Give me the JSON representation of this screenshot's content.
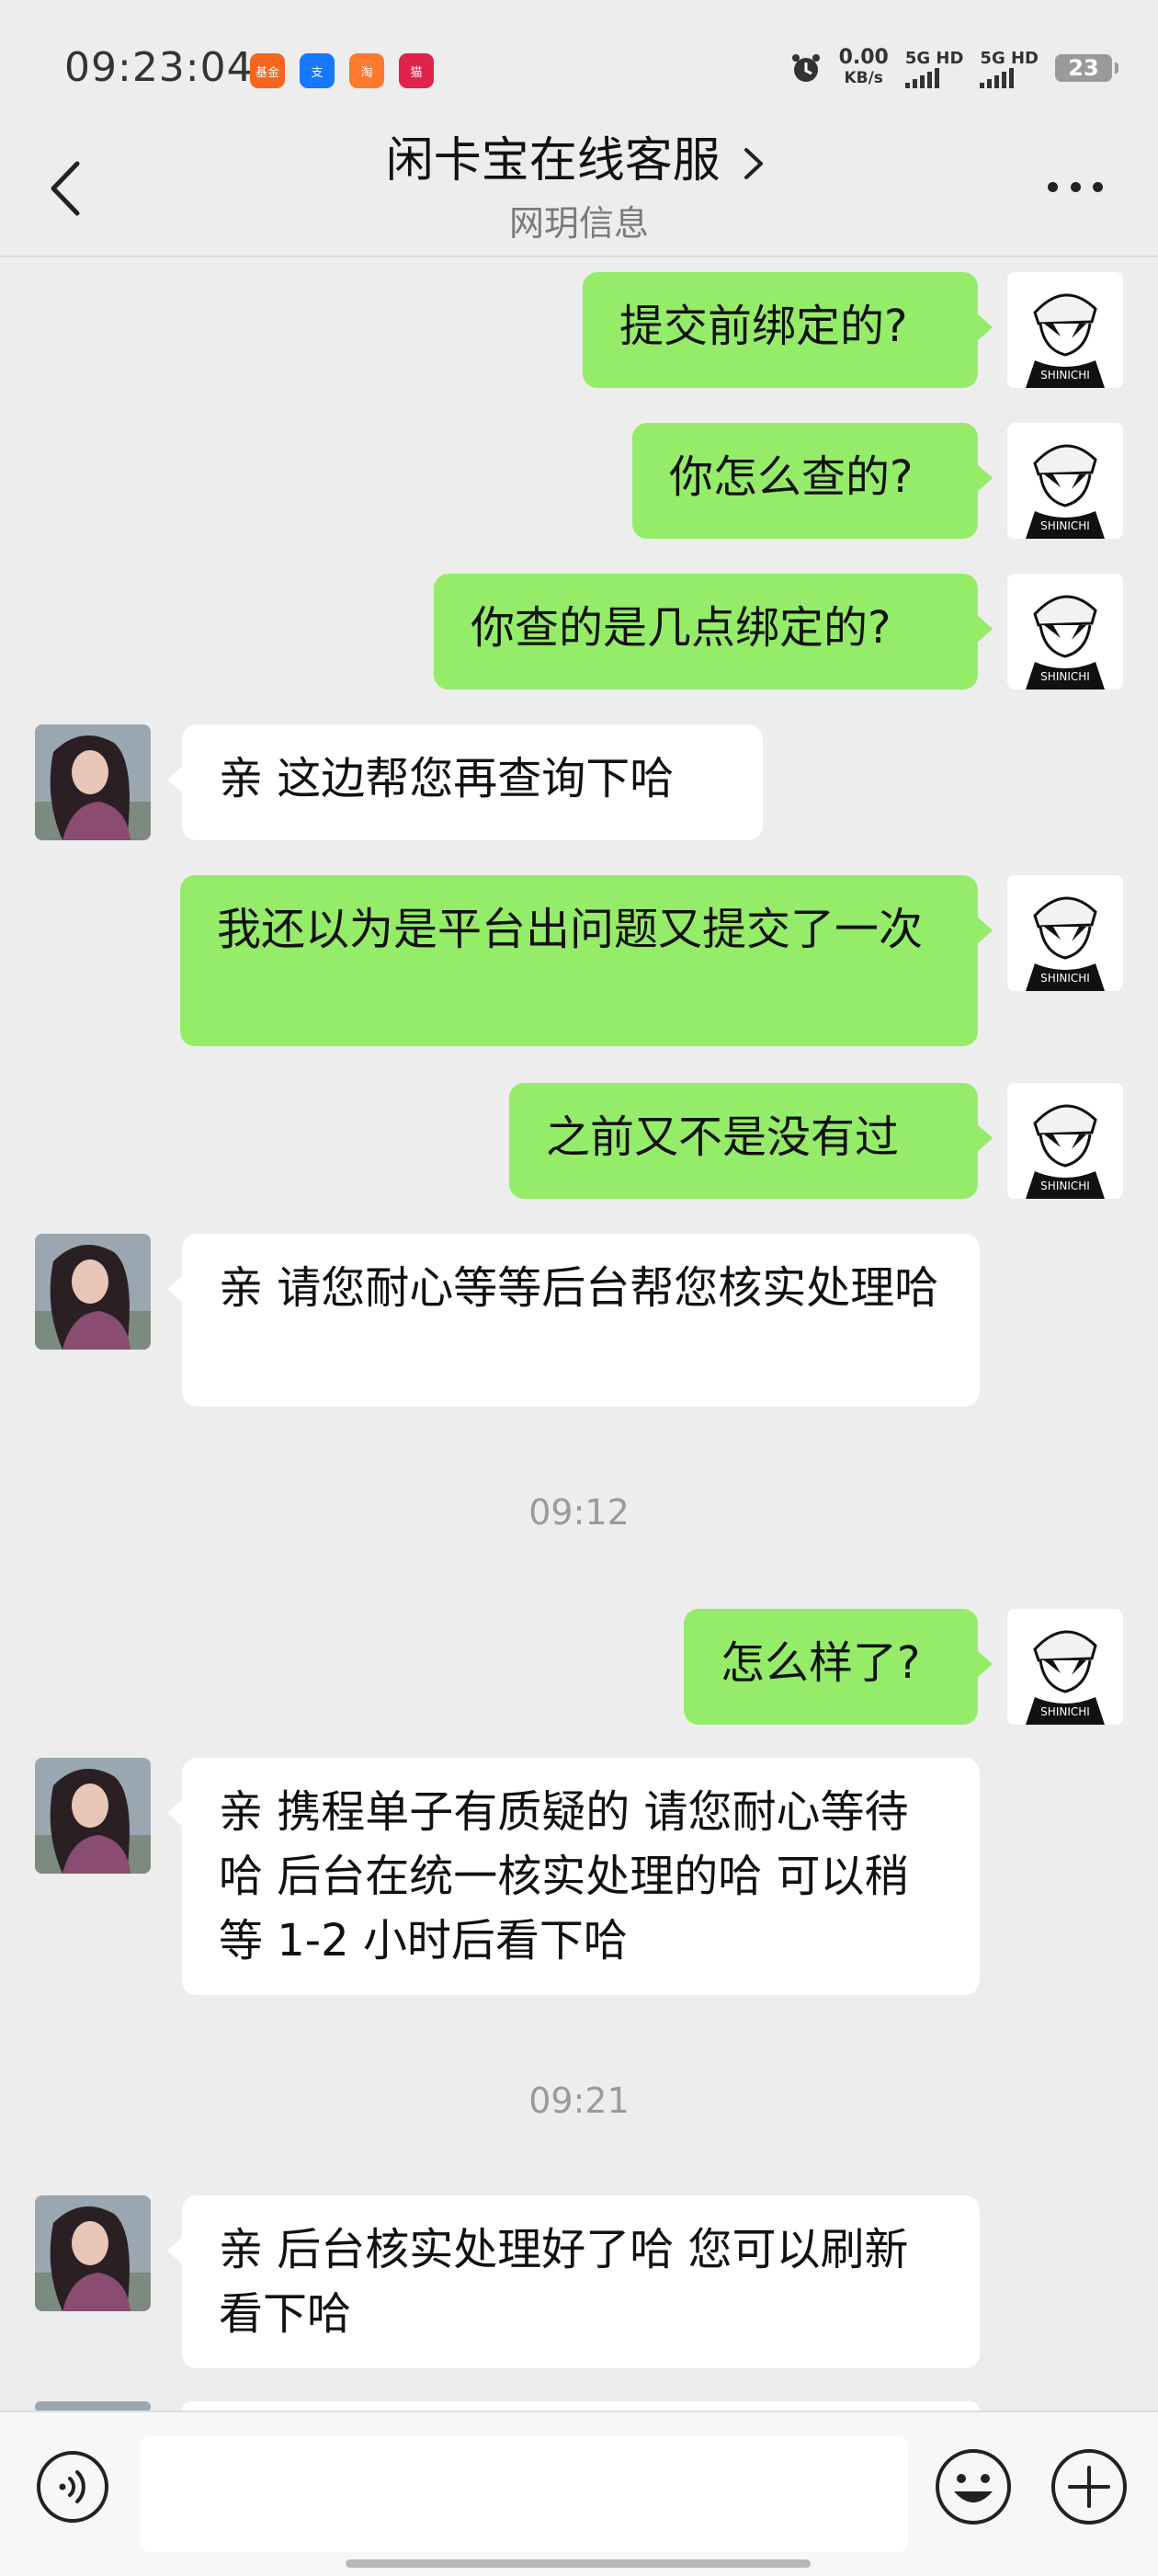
{
  "status_bar": {
    "time": "09:23:04",
    "app_icons": [
      {
        "name": "fund-app-icon",
        "label": "基金",
        "color": "#f7651e"
      },
      {
        "name": "alipay-app-icon",
        "label": "支",
        "color": "#1677ff"
      },
      {
        "name": "taobao-app-icon",
        "label": "淘",
        "color": "#ff7a2e"
      },
      {
        "name": "tmall-app-icon",
        "label": "猫",
        "color": "#e1224b"
      }
    ],
    "net_speed_value": "0.00",
    "net_speed_unit": "KB/s",
    "sim1": "5G HD",
    "sim2": "5G HD",
    "battery": "23"
  },
  "header": {
    "title": "闲卡宝在线客服",
    "subtitle": "网玥信息"
  },
  "messages": [
    {
      "side": "self",
      "text": "提交前绑定的?"
    },
    {
      "side": "self",
      "text": "你怎么查的?"
    },
    {
      "side": "self",
      "text": "你查的是几点绑定的?"
    },
    {
      "side": "other",
      "text": "亲 这边帮您再查询下哈"
    },
    {
      "side": "self",
      "text": "我还以为是平台出问题又提交了一次"
    },
    {
      "side": "self",
      "text": "之前又不是没有过"
    },
    {
      "side": "other",
      "text": "亲 请您耐心等等后台帮您核实处理哈"
    },
    {
      "side": "time",
      "text": "09:12"
    },
    {
      "side": "self",
      "text": "怎么样了?"
    },
    {
      "side": "other",
      "text": "亲 携程单子有质疑的 请您耐心等待哈 后台在统一核实处理的哈 可以稍等 1-2 小时后看下哈"
    },
    {
      "side": "time",
      "text": "09:21"
    },
    {
      "side": "other",
      "text": "亲 后台核实处理好了哈  您可以刷新看下哈"
    }
  ],
  "input": {
    "value": "",
    "placeholder": ""
  },
  "colors": {
    "self_bubble": "#95ec69",
    "other_bubble": "#ffffff",
    "background": "#ededed"
  }
}
